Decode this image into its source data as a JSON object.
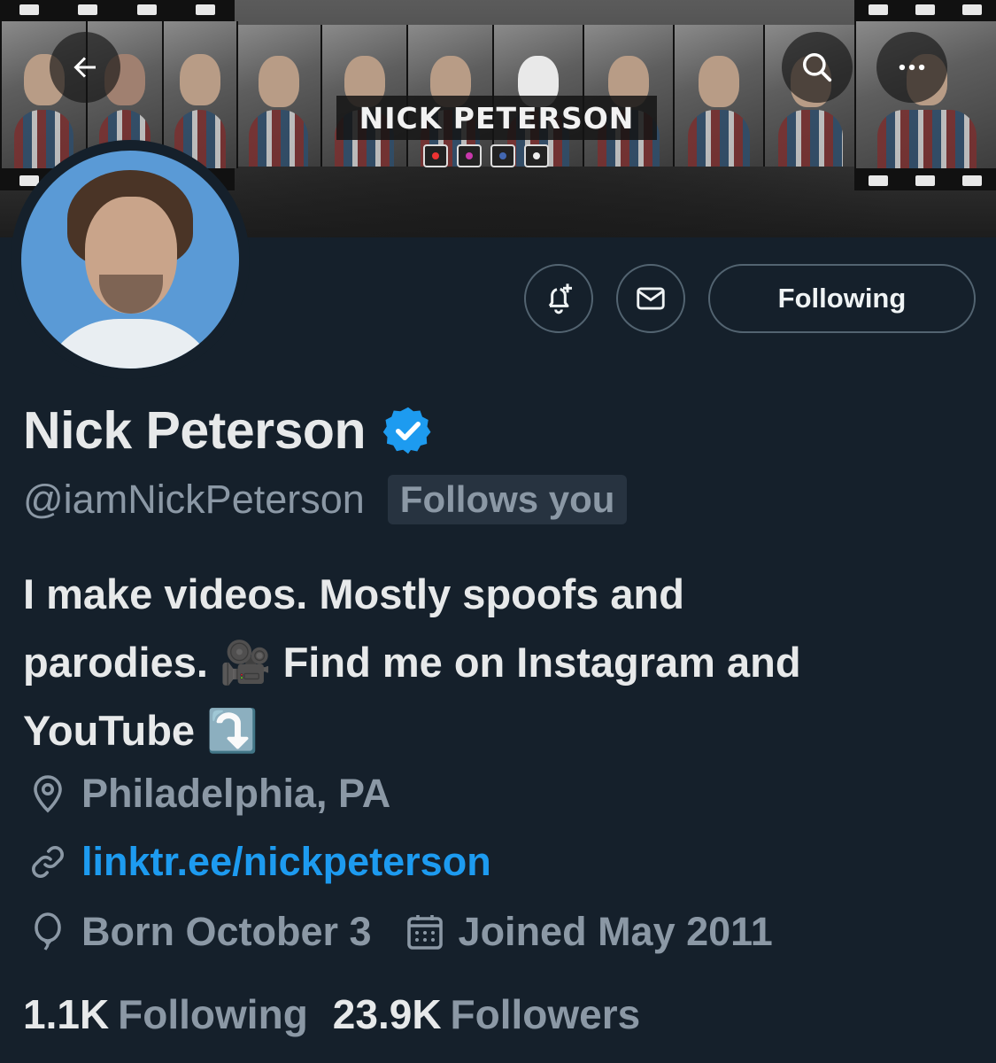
{
  "banner": {
    "title": "NICK PETERSON",
    "social_icons": [
      "youtube-icon",
      "instagram-icon",
      "facebook-icon",
      "tiktok-icon"
    ]
  },
  "header": {
    "back_icon": "arrow-left-icon",
    "search_icon": "search-icon",
    "more_icon": "more-horizontal-icon"
  },
  "actions": {
    "notify_icon": "bell-plus-icon",
    "message_icon": "envelope-icon",
    "following_label": "Following"
  },
  "profile": {
    "name": "Nick Peterson",
    "verified": true,
    "handle": "@iamNickPeterson",
    "follows_you": "Follows you",
    "bio_line1": "I make videos. Mostly spoofs and",
    "bio_line2": "parodies. 🎥 Find me on Instagram and",
    "bio_line3": "YouTube ⤵️",
    "location": "Philadelphia, PA",
    "website": "linktr.ee/nickpeterson",
    "born": "Born October 3",
    "joined": "Joined May 2011"
  },
  "stats": {
    "following_count": "1.1K",
    "following_label": "Following",
    "followers_count": "23.9K",
    "followers_label": "Followers"
  },
  "colors": {
    "background": "#15202b",
    "accent": "#1d9bf0",
    "muted": "#8b98a5",
    "verified": "#1d9bf0"
  }
}
